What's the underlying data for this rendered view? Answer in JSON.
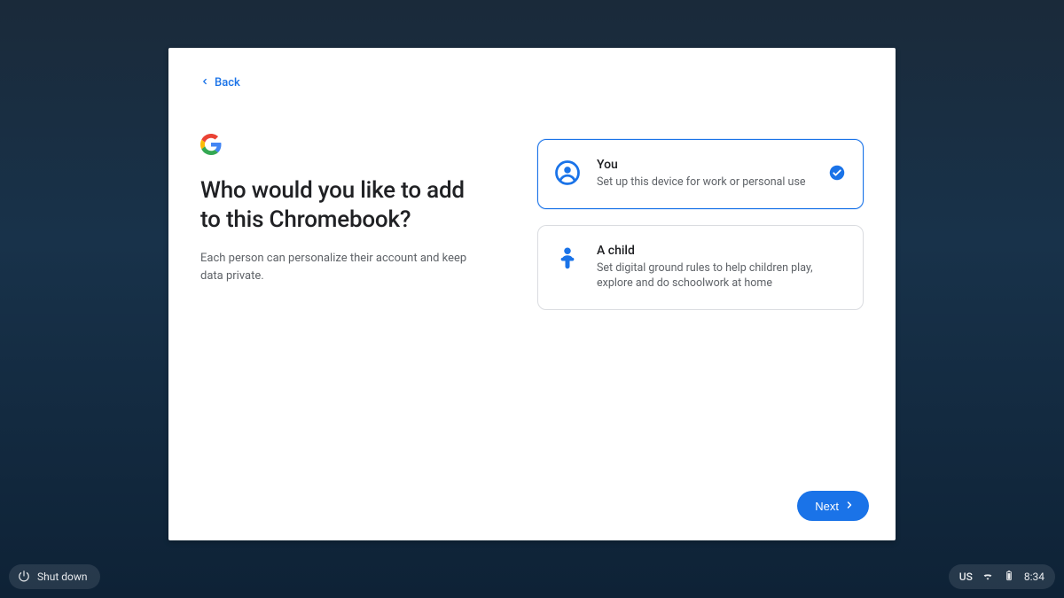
{
  "back": {
    "label": "Back"
  },
  "title": "Who would you like to add to this Chromebook?",
  "subtitle": "Each person can personalize their account and keep data private.",
  "options": [
    {
      "title": "You",
      "description": "Set up this device for work or personal use",
      "selected": true,
      "icon": "user-circle-icon"
    },
    {
      "title": "A child",
      "description": "Set digital ground rules to help children play, explore and do schoolwork at home",
      "selected": false,
      "icon": "child-icon"
    }
  ],
  "next": {
    "label": "Next"
  },
  "shelf": {
    "shutdown": "Shut down",
    "language": "US",
    "time": "8:34"
  },
  "colors": {
    "primary": "#1a73e8",
    "text": "#202124",
    "secondaryText": "#5f6368",
    "border": "#dadce0"
  }
}
